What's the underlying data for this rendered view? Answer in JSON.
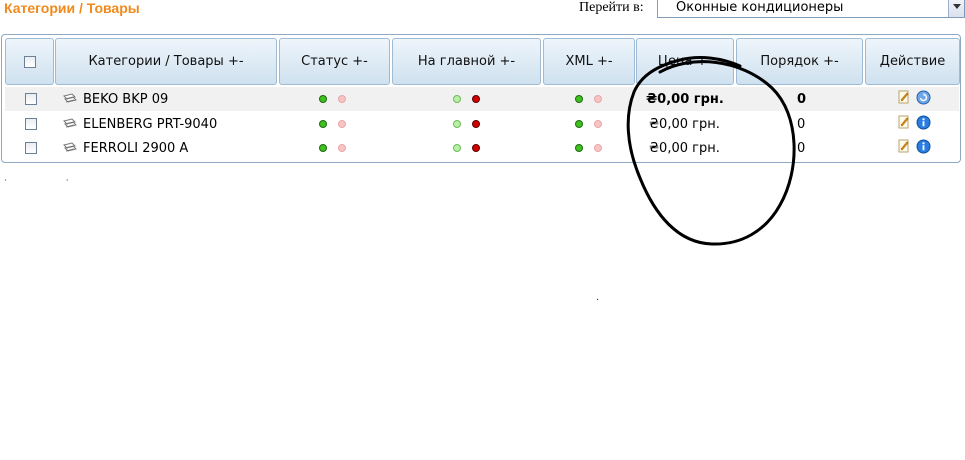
{
  "header": {
    "title": "Категории / Товары",
    "goto_label": "Перейти в:",
    "goto_value": "Оконные кондиционеры"
  },
  "table": {
    "columns": [
      "",
      "Категории / Товары +-",
      "Статус +-",
      "На главной +-",
      "XML +-",
      "Цена +-",
      "Порядок +-",
      "Действие"
    ],
    "rows": [
      {
        "name": "BEKO BKP 09",
        "price": "₴0,00 грн.",
        "order": "0"
      },
      {
        "name": "ELENBERG PRT-9040",
        "price": "₴0,00 грн.",
        "order": "0"
      },
      {
        "name": "FERROLI 2900 A",
        "price": "₴0,00 грн.",
        "order": "0"
      }
    ]
  },
  "footer": {
    "text": "· ·"
  },
  "colors": {
    "title": "#f08a1c",
    "header_bg": "#cfe1ef",
    "status_on": "#3fc21f",
    "main_on": "#d40000"
  }
}
